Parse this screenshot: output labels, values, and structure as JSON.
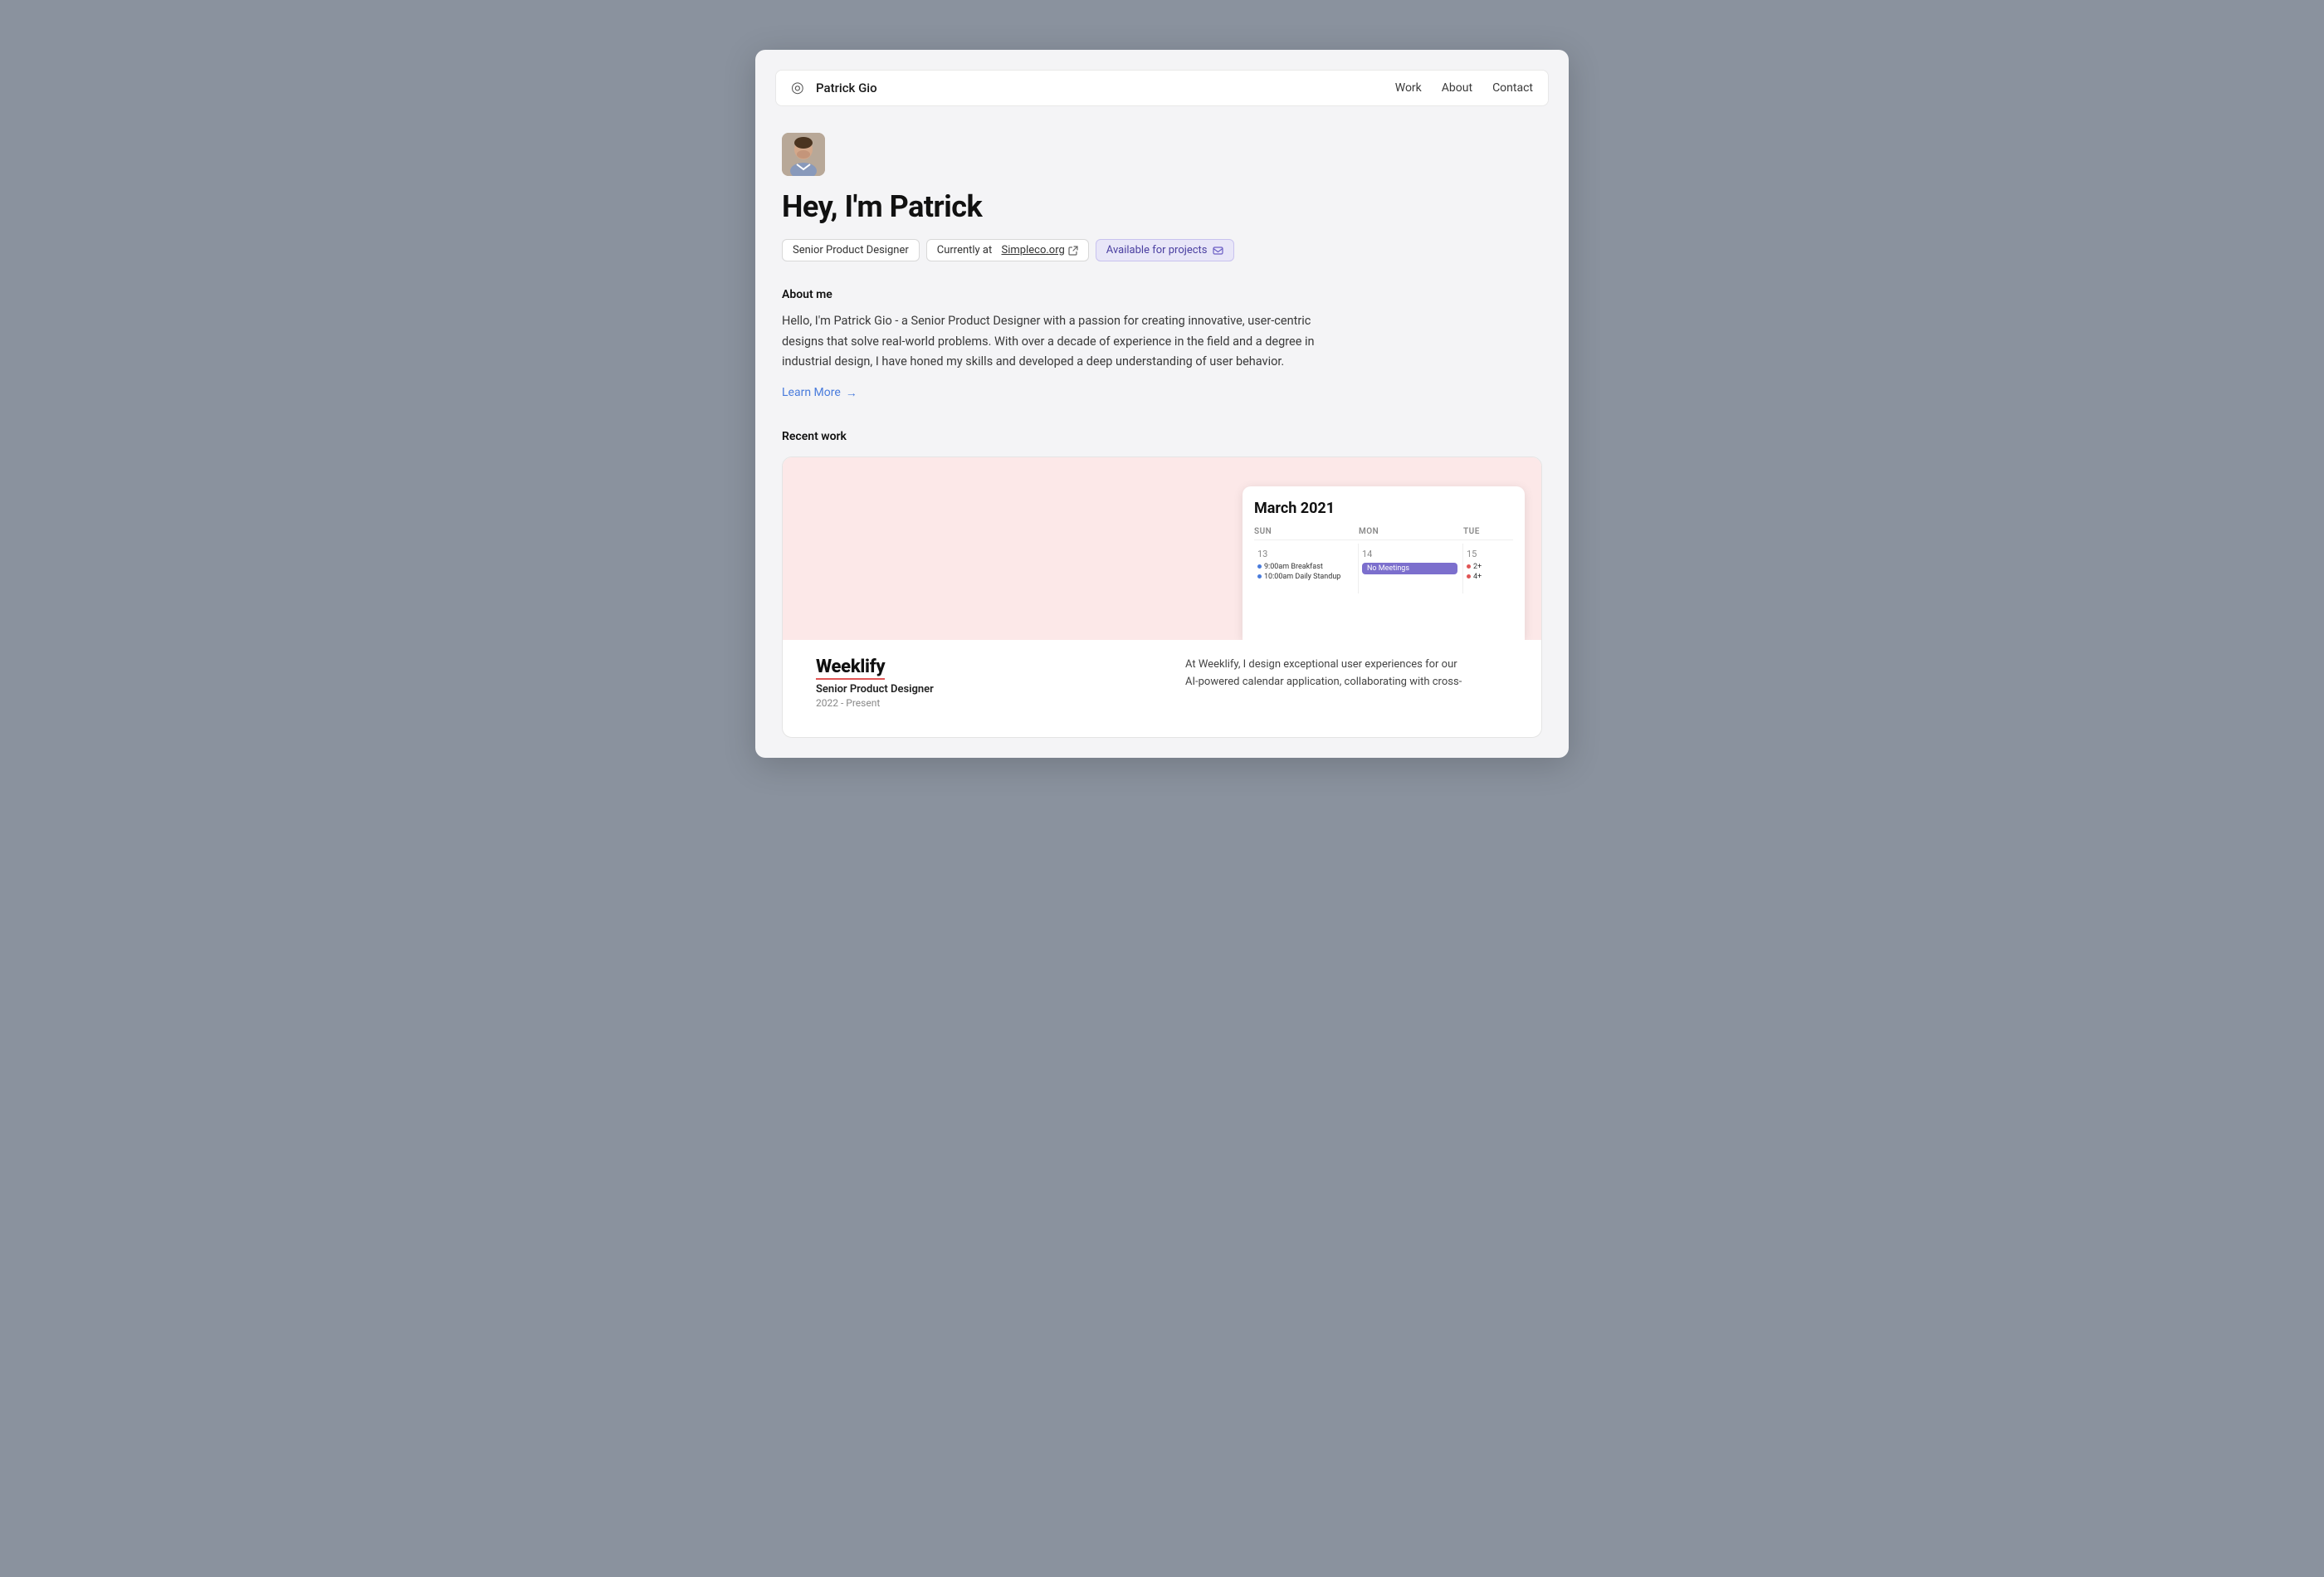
{
  "window": {
    "bg": "#8a929e"
  },
  "navbar": {
    "brand": "Patrick Gio",
    "logo_icon": "◎",
    "links": [
      {
        "label": "Work",
        "id": "work"
      },
      {
        "label": "About",
        "id": "about"
      },
      {
        "label": "Contact",
        "id": "contact"
      }
    ]
  },
  "hero": {
    "title": "Hey, I'm Patrick",
    "badge_role": "Senior Product Designer",
    "badge_company_prefix": "Currently at",
    "badge_company_name": "Simpleco.org",
    "badge_available": "Available for projects"
  },
  "about": {
    "section_label": "About me",
    "text": "Hello, I'm Patrick Gio - a Senior Product Designer with a passion for creating innovative, user-centric designs that solve real-world problems. With over a decade of experience in the field and a degree in industrial design, I have honed my skills and developed a deep understanding of user behavior.",
    "learn_more": "Learn More"
  },
  "recent_work": {
    "section_label": "Recent work",
    "project": {
      "name": "Weeklify",
      "role": "Senior Product Designer",
      "years": "2022 - Present",
      "description": "At Weeklify, I design exceptional user experiences for our AI-powered calendar application, collaborating with cross-",
      "calendar": {
        "title": "March 2021",
        "days": [
          "SUN",
          "MON",
          "TUE"
        ],
        "dates": [
          "13",
          "14",
          "15"
        ],
        "events_sun": [
          "9:00am Breakfast",
          "10:00am Daily Standup"
        ],
        "events_mon": "No Meetings",
        "events_tue": [
          "2+",
          "4+"
        ]
      }
    }
  }
}
